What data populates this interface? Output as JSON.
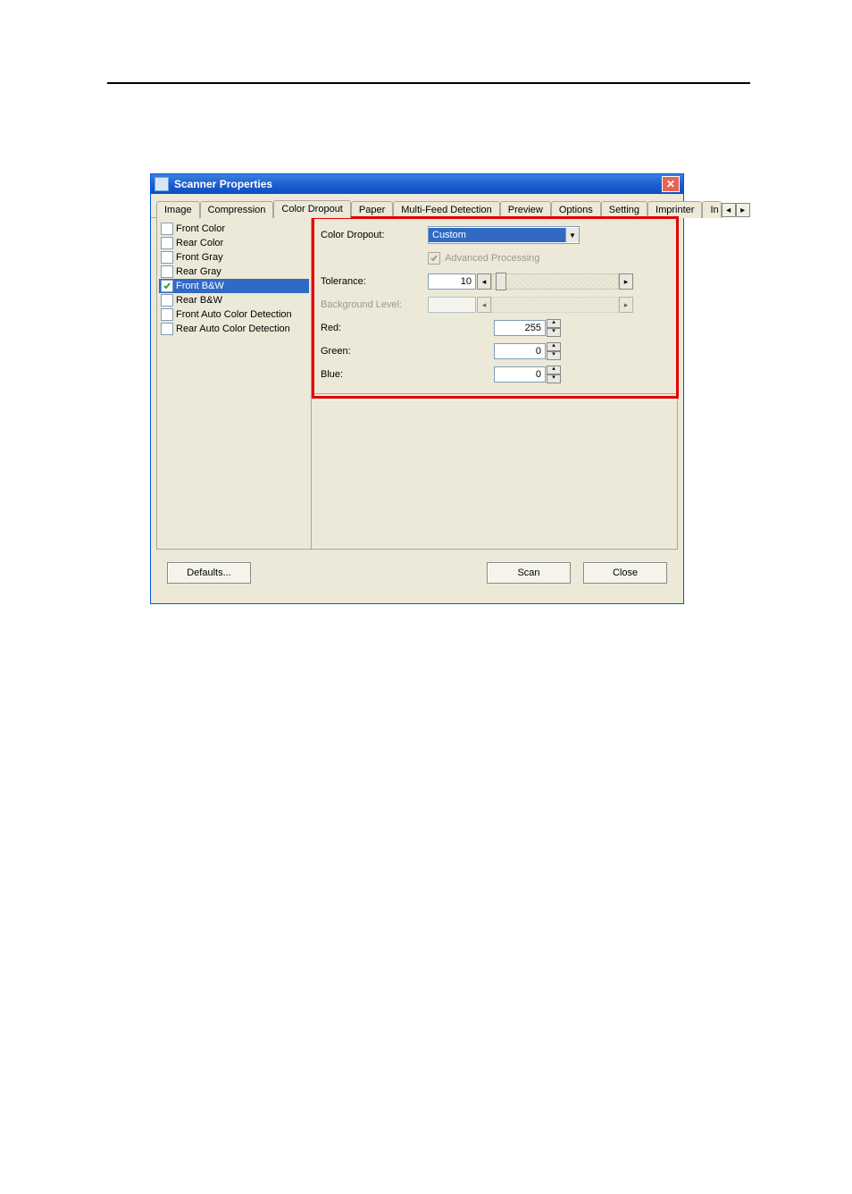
{
  "window": {
    "title": "Scanner Properties"
  },
  "tabs": [
    "Image",
    "Compression",
    "Color Dropout",
    "Paper",
    "Multi-Feed Detection",
    "Preview",
    "Options",
    "Setting",
    "Imprinter",
    "In"
  ],
  "modes": [
    {
      "label": "Front Color",
      "checked": false
    },
    {
      "label": "Rear Color",
      "checked": false
    },
    {
      "label": "Front Gray",
      "checked": false
    },
    {
      "label": "Rear Gray",
      "checked": false
    },
    {
      "label": "Front B&W",
      "checked": true,
      "selected": true
    },
    {
      "label": "Rear B&W",
      "checked": false
    },
    {
      "label": "Front Auto Color Detection",
      "checked": false
    },
    {
      "label": "Rear Auto Color Detection",
      "checked": false
    }
  ],
  "panel": {
    "colorDropout": {
      "label": "Color Dropout:",
      "value": "Custom"
    },
    "advanced": "Advanced Processing",
    "tolerance": {
      "label": "Tolerance:",
      "value": "10"
    },
    "background": {
      "label": "Background Level:",
      "value": ""
    },
    "red": {
      "label": "Red:",
      "value": "255"
    },
    "green": {
      "label": "Green:",
      "value": "0"
    },
    "blue": {
      "label": "Blue:",
      "value": "0"
    }
  },
  "buttons": {
    "defaults": "Defaults...",
    "scan": "Scan",
    "close": "Close"
  }
}
